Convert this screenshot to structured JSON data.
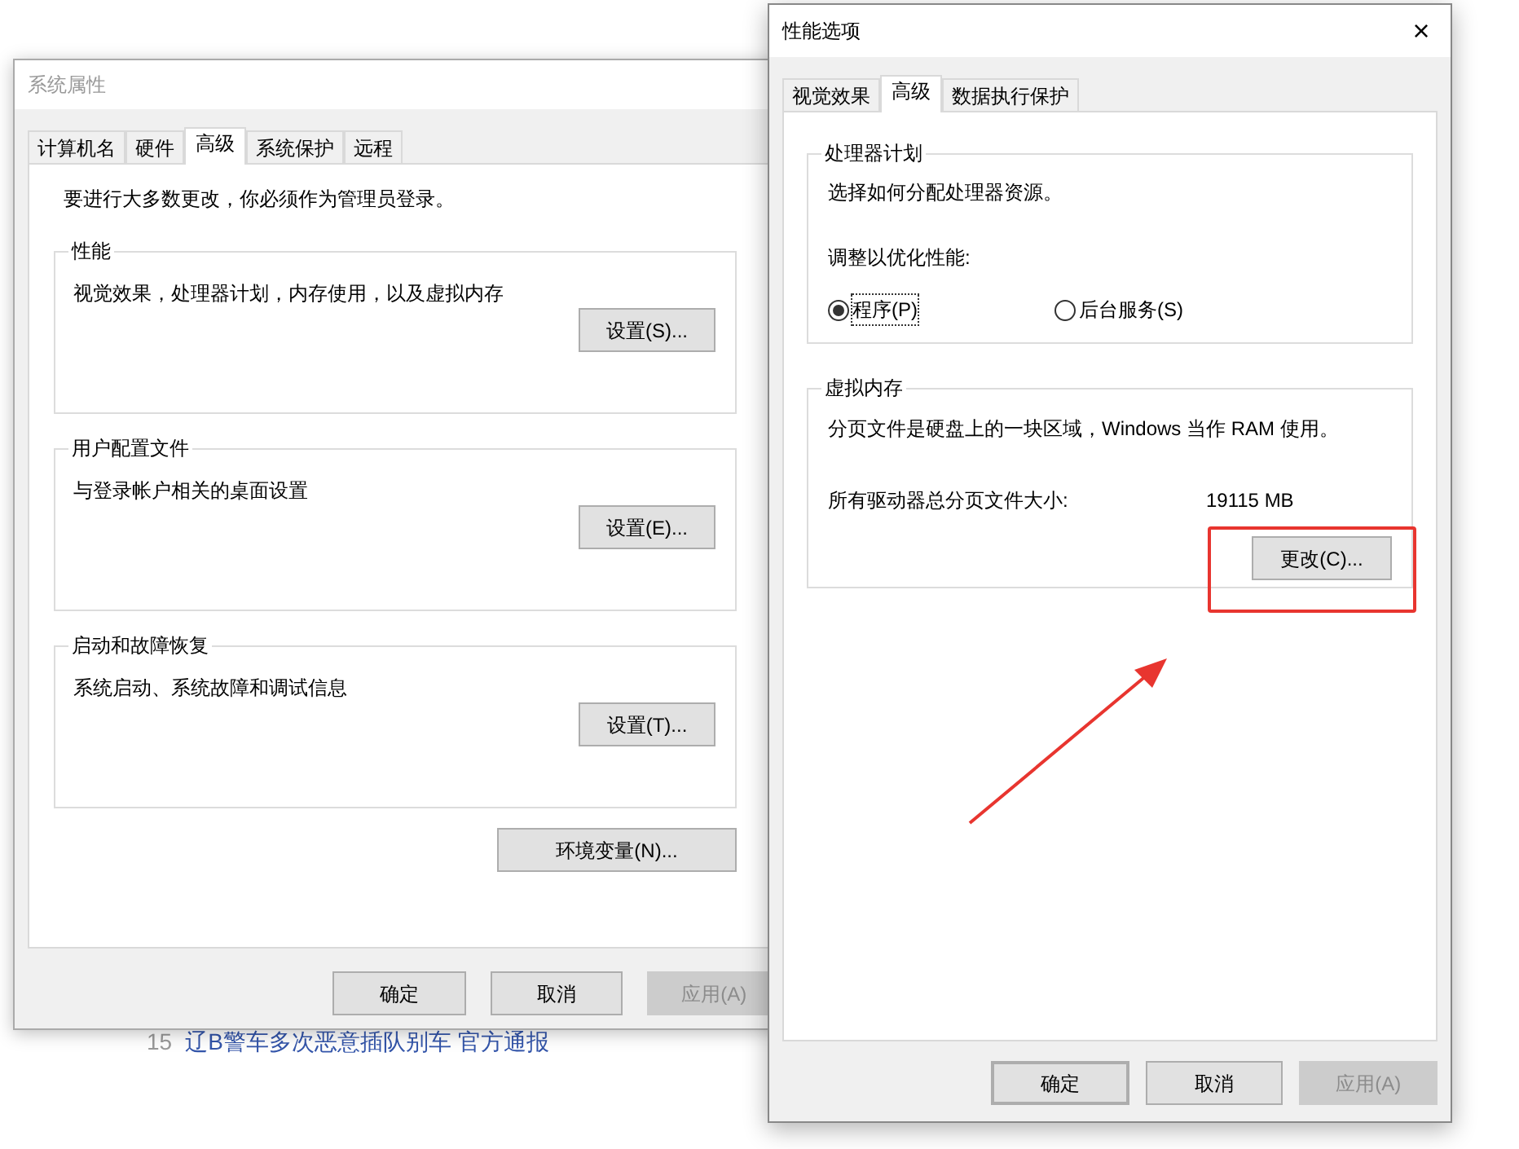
{
  "background_list": [
    {
      "rank": "15",
      "title": "辽B警车多次恶意插队别车 官方通报"
    }
  ],
  "system_properties": {
    "title": "系统属性",
    "tabs": [
      {
        "label": "计算机名",
        "selected": false
      },
      {
        "label": "硬件",
        "selected": false
      },
      {
        "label": "高级",
        "selected": true
      },
      {
        "label": "系统保护",
        "selected": false
      },
      {
        "label": "远程",
        "selected": false
      }
    ],
    "notice": "要进行大多数更改，你必须作为管理员登录。",
    "groups": [
      {
        "title": "性能",
        "description": "视觉效果，处理器计划，内存使用，以及虚拟内存",
        "button": "设置(S)..."
      },
      {
        "title": "用户配置文件",
        "description": "与登录帐户相关的桌面设置",
        "button": "设置(E)..."
      },
      {
        "title": "启动和故障恢复",
        "description": "系统启动、系统故障和调试信息",
        "button": "设置(T)..."
      }
    ],
    "env_button": "环境变量(N)...",
    "buttons": [
      {
        "label": "确定",
        "disabled": false
      },
      {
        "label": "取消",
        "disabled": false
      },
      {
        "label": "应用(A)",
        "disabled": true
      }
    ]
  },
  "performance_options": {
    "title": "性能选项",
    "close": "×",
    "tabs": [
      {
        "label": "视觉效果",
        "selected": false
      },
      {
        "label": "高级",
        "selected": true
      },
      {
        "label": "数据执行保护",
        "selected": false
      }
    ],
    "processor": {
      "title": "处理器计划",
      "description": "选择如何分配处理器资源。",
      "prompt": "调整以优化性能:",
      "options": [
        {
          "label": "程序(P)",
          "selected": true
        },
        {
          "label": "后台服务(S)",
          "selected": false
        }
      ]
    },
    "virtual_memory": {
      "title": "虚拟内存",
      "description": "分页文件是硬盘上的一块区域，Windows 当作 RAM 使用。",
      "total_label": "所有驱动器总分页文件大小:",
      "total_value": "19115 MB",
      "button": "更改(C)..."
    },
    "buttons": [
      {
        "label": "确定",
        "disabled": false,
        "default": true
      },
      {
        "label": "取消",
        "disabled": false,
        "default": false
      },
      {
        "label": "应用(A)",
        "disabled": true,
        "default": false
      }
    ]
  }
}
